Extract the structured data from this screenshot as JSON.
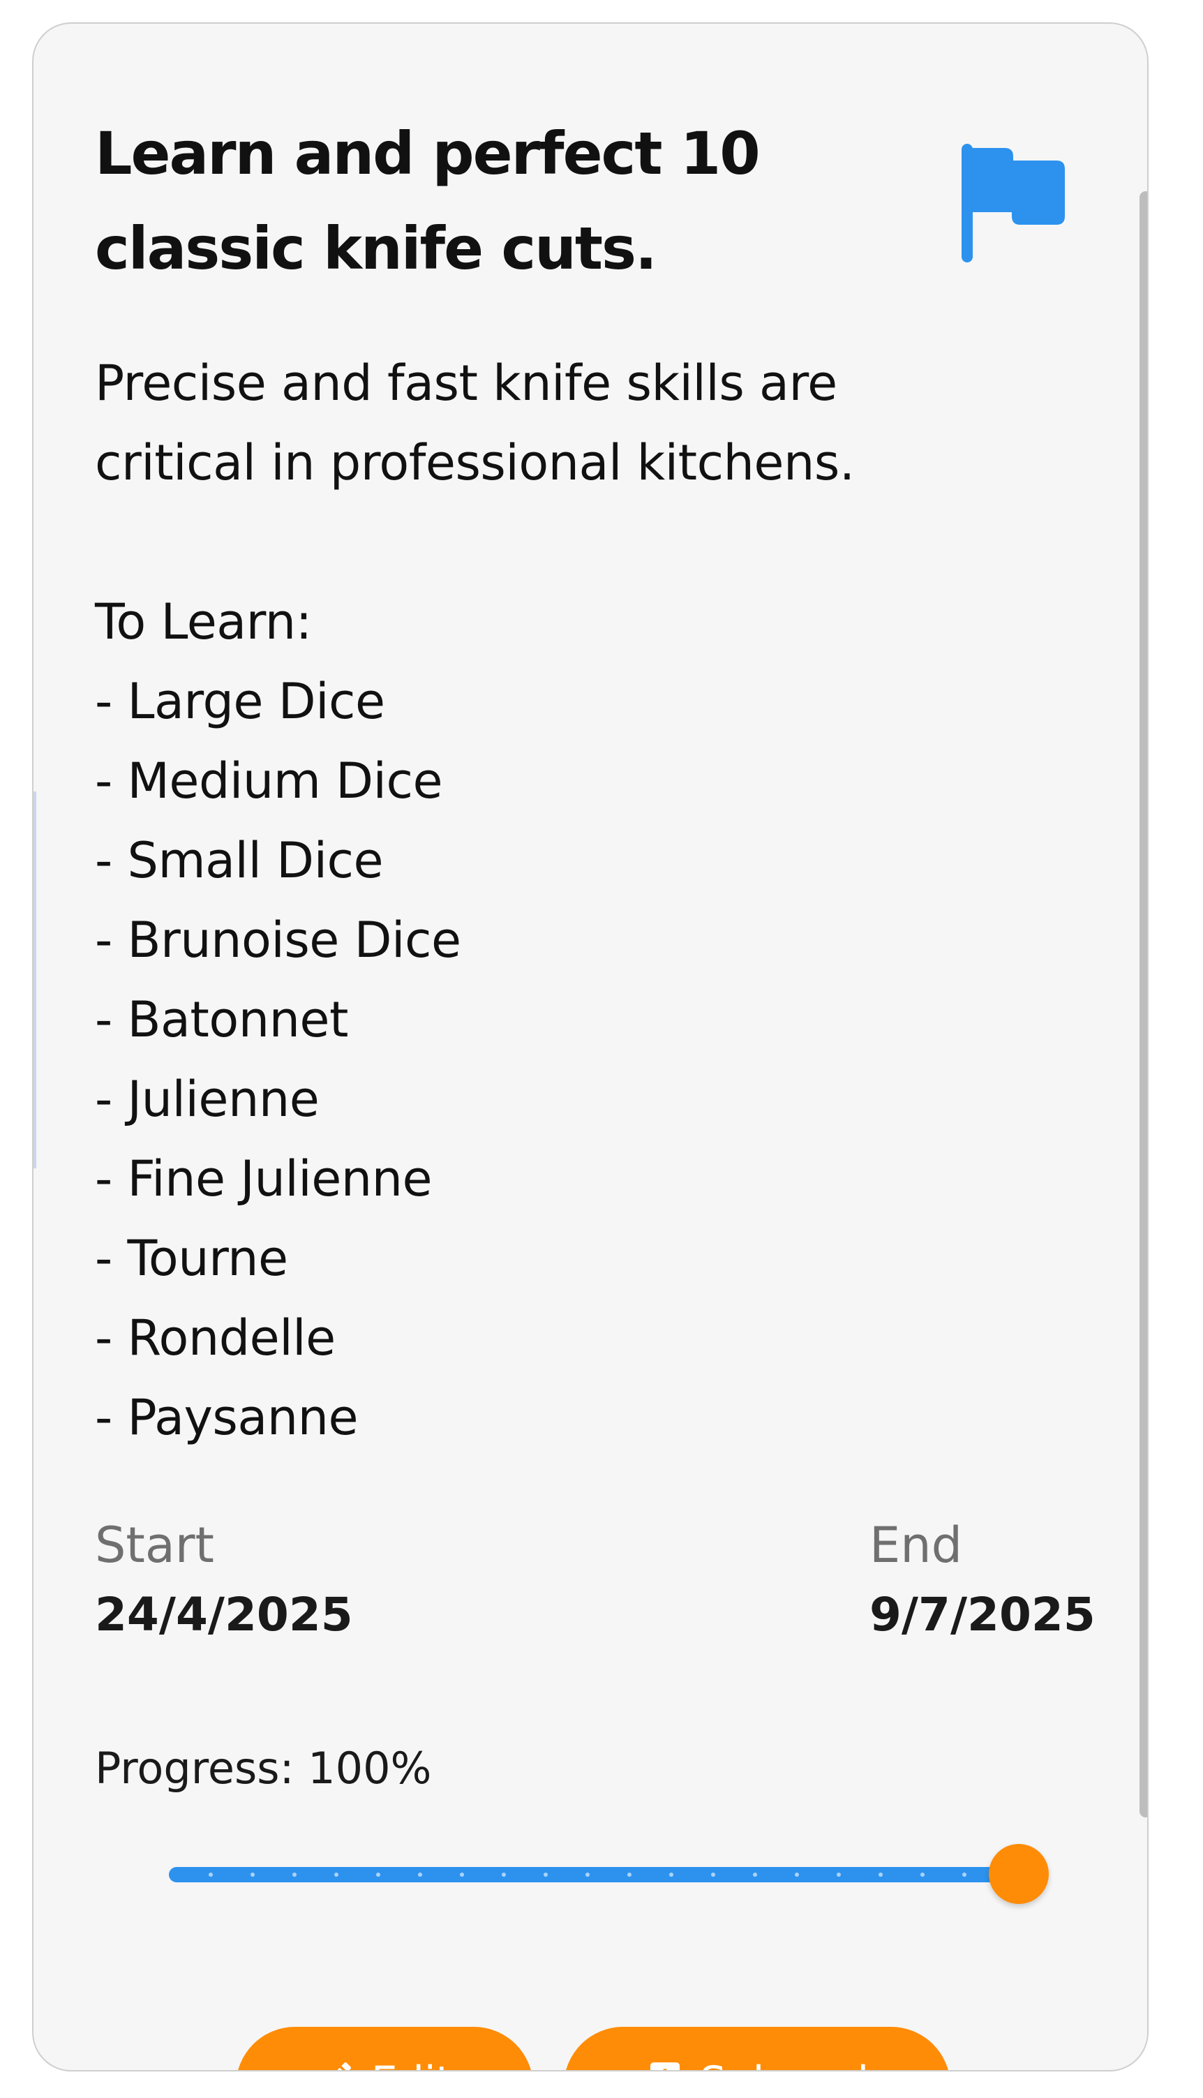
{
  "goal": {
    "title": "Learn and perfect 10 classic knife cuts.",
    "flag_icon": "flag-icon",
    "flag_color": "#2c92ee",
    "description_line_1": "Precise and fast knife skills are",
    "description_line_2": "critical in professional kitchens.",
    "to_learn_heading": "To Learn:",
    "to_learn_items": [
      "- Large Dice",
      "- Medium Dice",
      "- Small Dice",
      "- Brunoise Dice",
      "- Batonnet",
      "- Julienne",
      "- Fine Julienne",
      "- Tourne",
      "- Rondelle",
      "- Paysanne"
    ]
  },
  "dates": {
    "start_label": "Start",
    "start_value": "24/4/2025",
    "end_label": "End",
    "end_value": "9/7/2025"
  },
  "progress": {
    "label": "Progress: 100%",
    "value": 100,
    "track_color": "#2c92ee",
    "thumb_color": "#ff8c06"
  },
  "actions": {
    "edit_label": "Edit",
    "edit_icon": "pencil-icon",
    "subgoal_label": "Subgoal",
    "subgoal_icon": "add-box-icon",
    "button_color": "#ff8c06"
  }
}
